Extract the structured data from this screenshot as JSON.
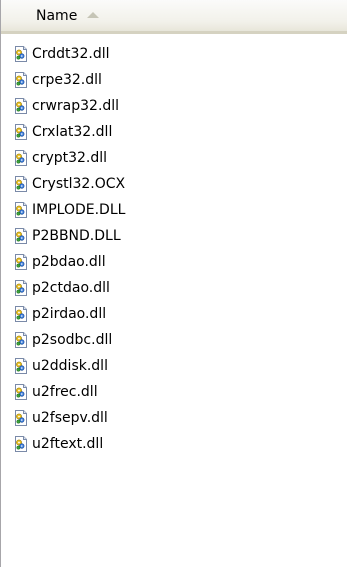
{
  "header": {
    "name_label": "Name"
  },
  "files": [
    {
      "name": "Crddt32.dll",
      "icon": "dll-file-icon"
    },
    {
      "name": "crpe32.dll",
      "icon": "dll-file-icon"
    },
    {
      "name": "crwrap32.dll",
      "icon": "dll-file-icon"
    },
    {
      "name": "Crxlat32.dll",
      "icon": "dll-file-icon"
    },
    {
      "name": "crypt32.dll",
      "icon": "dll-file-icon"
    },
    {
      "name": "Crystl32.OCX",
      "icon": "ocx-file-icon"
    },
    {
      "name": "IMPLODE.DLL",
      "icon": "dll-file-icon"
    },
    {
      "name": "P2BBND.DLL",
      "icon": "dll-file-icon"
    },
    {
      "name": "p2bdao.dll",
      "icon": "dll-file-icon"
    },
    {
      "name": "p2ctdao.dll",
      "icon": "dll-file-icon"
    },
    {
      "name": "p2irdao.dll",
      "icon": "dll-file-icon"
    },
    {
      "name": "p2sodbc.dll",
      "icon": "dll-file-icon"
    },
    {
      "name": "u2ddisk.dll",
      "icon": "dll-file-icon"
    },
    {
      "name": "u2frec.dll",
      "icon": "dll-file-icon"
    },
    {
      "name": "u2fsepv.dll",
      "icon": "dll-file-icon"
    },
    {
      "name": "u2ftext.dll",
      "icon": "dll-file-icon"
    }
  ],
  "colors": {
    "header_bottom": "#d5d2c1",
    "sort_arrow": "#c6c5b6",
    "icon_page": "#ffffff",
    "icon_border": "#7a8aa8",
    "gear_yellow": "#e8c020",
    "gear_blue": "#3a7ad8",
    "gear_green": "#3aa03a"
  }
}
